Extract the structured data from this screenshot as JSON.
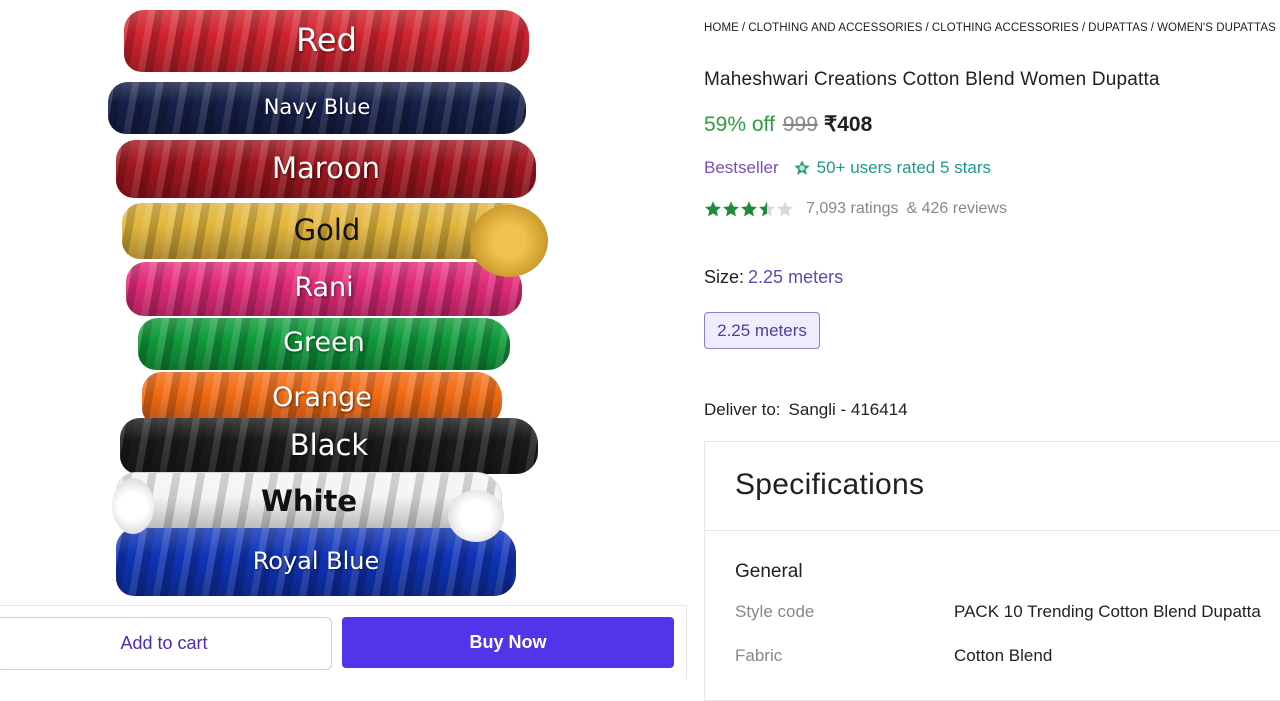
{
  "image": {
    "rolls": [
      {
        "label": "Red",
        "color": "#d2232e"
      },
      {
        "label": "Navy Blue",
        "color": "#16204a"
      },
      {
        "label": "Maroon",
        "color": "#a4161f"
      },
      {
        "label": "Gold",
        "color": "#e2b53b"
      },
      {
        "label": "Rani",
        "color": "#e42b79"
      },
      {
        "label": "Green",
        "color": "#0f9b3a"
      },
      {
        "label": "Orange",
        "color": "#f26a13"
      },
      {
        "label": "Black",
        "color": "#1b1b1b"
      },
      {
        "label": "White",
        "color": "#f4f4f4"
      },
      {
        "label": "Royal Blue",
        "color": "#0f34b8"
      }
    ]
  },
  "actions": {
    "add_to_cart": "Add to cart",
    "buy_now": "Buy Now"
  },
  "breadcrumb": [
    "HOME",
    "CLOTHING AND ACCESSORIES",
    "CLOTHING ACCESSORIES",
    "DUPATTAS",
    "WOMEN'S DUPATTAS"
  ],
  "product": {
    "title": "Maheshwari Creations Cotton Blend Women Dupatta",
    "discount": "59% off",
    "mrp": "999",
    "price": "₹408",
    "bestseller": "Bestseller",
    "users_rated": "50+ users rated 5 stars",
    "rating_value": 3.5,
    "ratings": "7,093 ratings",
    "reviews": "& 426 reviews"
  },
  "size": {
    "label": "Size:",
    "selected": "2.25 meters",
    "options": [
      "2.25 meters"
    ]
  },
  "delivery": {
    "label": "Deliver to:",
    "location": "Sangli - 416414"
  },
  "specifications": {
    "header": "Specifications",
    "section": "General",
    "rows": [
      {
        "key": "Style code",
        "value": "PACK 10 Trending Cotton Blend Dupatta"
      },
      {
        "key": "Fabric",
        "value": "Cotton Blend"
      }
    ]
  },
  "colors": {
    "discount_green": "#2e9b3e",
    "buy_button": "#5235e8",
    "star_green": "#1f8a3a",
    "bestseller_purple": "#7a4fb3"
  }
}
